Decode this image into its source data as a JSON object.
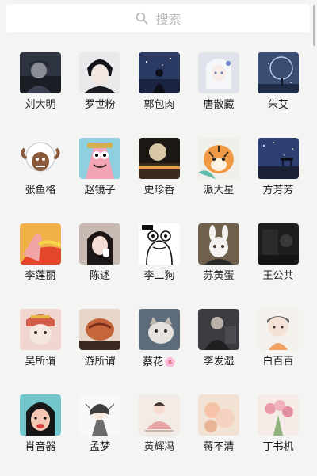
{
  "search": {
    "placeholder": "搜索"
  },
  "contacts": [
    {
      "name": "刘大明",
      "avatar": "dark-portrait"
    },
    {
      "name": "罗世粉",
      "avatar": "anime-boy"
    },
    {
      "name": "郭包肉",
      "avatar": "night-silhouette"
    },
    {
      "name": "唐散藏",
      "avatar": "anime-girl"
    },
    {
      "name": "朱艾",
      "avatar": "moon-sky"
    },
    {
      "name": "张鱼格",
      "avatar": "sheep-cartoon"
    },
    {
      "name": "赵镜子",
      "avatar": "patrick-cartoon"
    },
    {
      "name": "史珍香",
      "avatar": "full-moon"
    },
    {
      "name": "派大星",
      "avatar": "tiger-cartoon"
    },
    {
      "name": "方芳芳",
      "avatar": "starry-night"
    },
    {
      "name": "李莲丽",
      "avatar": "patrick-fire"
    },
    {
      "name": "陈述",
      "avatar": "girl-photo"
    },
    {
      "name": "李二狗",
      "avatar": "frog-sketch"
    },
    {
      "name": "苏黄蛋",
      "avatar": "rabbit-mask"
    },
    {
      "name": "王公共",
      "avatar": "dark-photo"
    },
    {
      "name": "吴所谓",
      "avatar": "cat-costume"
    },
    {
      "name": "游所谓",
      "avatar": "food-photo"
    },
    {
      "name": "蔡花",
      "suffix": "🌸",
      "avatar": "cat-photo"
    },
    {
      "name": "李发湿",
      "avatar": "man-photo"
    },
    {
      "name": "白百百",
      "avatar": "chibi-boy"
    },
    {
      "name": "肖音器",
      "avatar": "cartoon-face"
    },
    {
      "name": "孟梦",
      "avatar": "girl-drawing"
    },
    {
      "name": "黄辉冯",
      "avatar": "meditating-girl"
    },
    {
      "name": "蒋不清",
      "avatar": "roses-photo"
    },
    {
      "name": "丁书机",
      "avatar": "flower-bouquet"
    }
  ],
  "colors": {
    "background": "#f4f4f3",
    "search_placeholder": "#b7b7b7",
    "name_text": "#1f1f1f"
  }
}
